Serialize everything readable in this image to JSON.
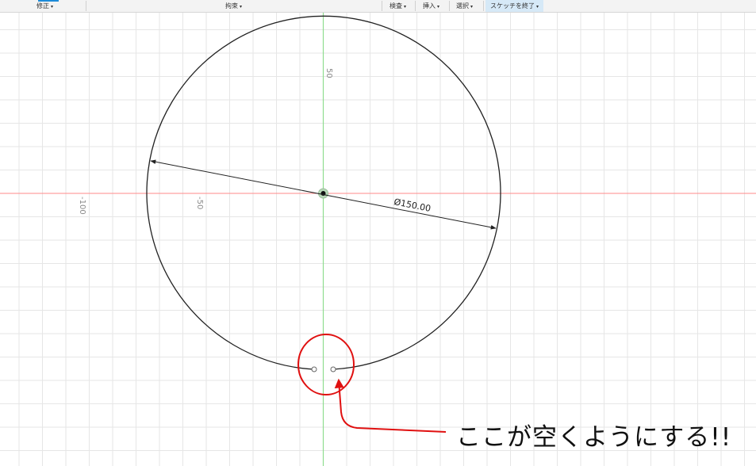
{
  "toolbar": {
    "modify": "修正",
    "constraints": "拘束",
    "inspect": "検査",
    "insert": "挿入",
    "select": "選択",
    "finish_sketch": "スケッチを終了",
    "caret": "▾"
  },
  "sketch": {
    "axis_label_50": "50",
    "axis_label_neg50": "-50",
    "axis_label_neg100": "-100",
    "diameter_dimension": "Ø150.00"
  },
  "annotation": {
    "text": "ここが空くようにする!!"
  },
  "colors": {
    "x_axis": "#ff8080",
    "y_axis": "#88dd88",
    "grid": "#e4e4e4",
    "sketch_line": "#222222",
    "annotation_red": "#e01010",
    "active_tab": "#d6e9f7"
  }
}
